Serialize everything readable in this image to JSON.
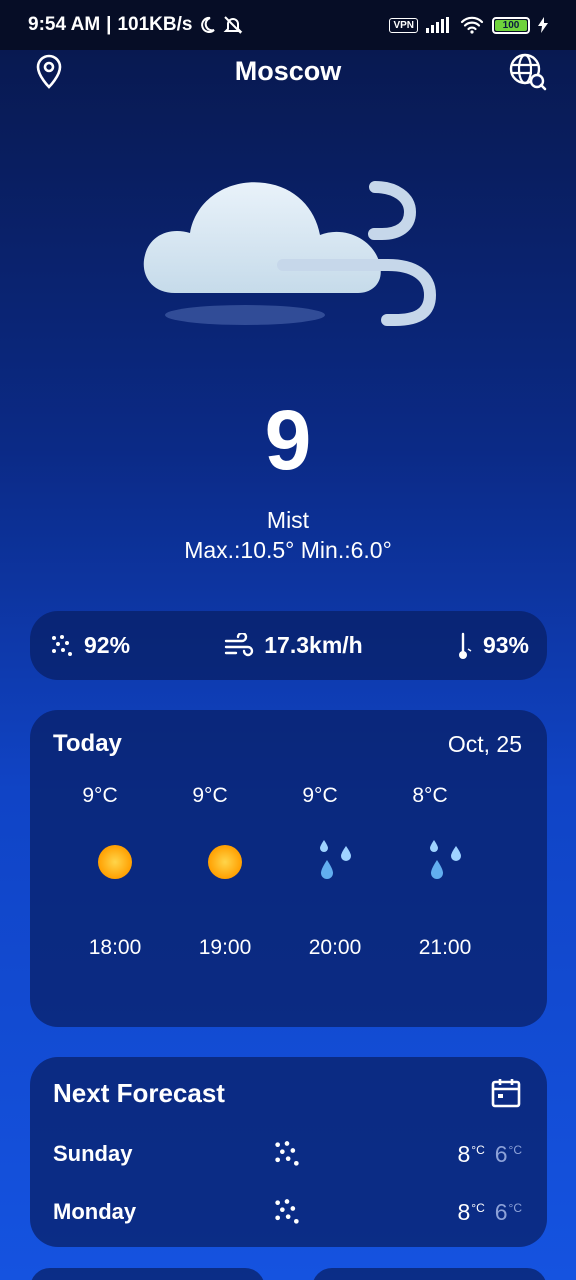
{
  "status_bar": {
    "time": "9:54 AM",
    "separator": "|",
    "net_speed": "101KB/s",
    "vpn_label": "VPN",
    "battery_level": "100"
  },
  "header": {
    "city": "Moscow"
  },
  "current": {
    "temperature": "9",
    "condition": "Mist",
    "minmax": "Max.:10.5° Min.:6.0°"
  },
  "stats": {
    "humidity": "92%",
    "wind": "17.3km/h",
    "feels": "93%"
  },
  "today": {
    "title": "Today",
    "date": "Oct, 25",
    "hours": [
      {
        "temp": "9°C",
        "time": "18:00",
        "icon": "sun-icon"
      },
      {
        "temp": "9°C",
        "time": "19:00",
        "icon": "sun-icon"
      },
      {
        "temp": "9°C",
        "time": "20:00",
        "icon": "raindrops-icon"
      },
      {
        "temp": "8°C",
        "time": "21:00",
        "icon": "raindrops-icon"
      }
    ]
  },
  "forecast": {
    "title": "Next Forecast",
    "days": [
      {
        "day": "Sunday",
        "high": "8",
        "low": "6",
        "unit": "°C",
        "icon": "rain-dots-icon"
      },
      {
        "day": "Monday",
        "high": "8",
        "low": "6",
        "unit": "°C",
        "icon": "rain-dots-icon"
      }
    ]
  },
  "colors": {
    "bg_top": "#08174a",
    "bg_bottom": "#1553e0",
    "card": "#0a1e64",
    "sun": "#ffb400",
    "drop": "#8ecbff"
  }
}
